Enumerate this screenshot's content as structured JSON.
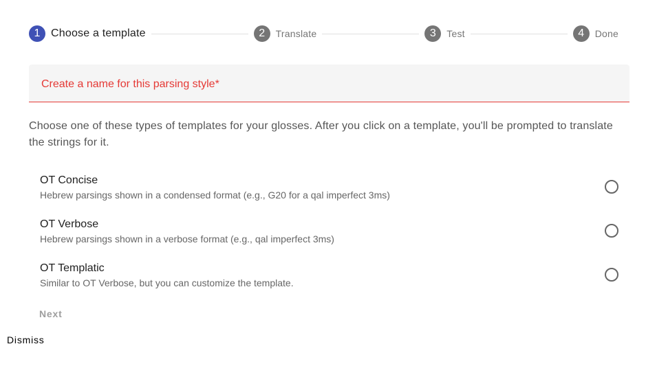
{
  "stepper": {
    "steps": [
      {
        "number": "1",
        "label": "Choose a template"
      },
      {
        "number": "2",
        "label": "Translate"
      },
      {
        "number": "3",
        "label": "Test"
      },
      {
        "number": "4",
        "label": "Done"
      }
    ],
    "active_step": "1"
  },
  "name_field": {
    "placeholder": "Create a name for this parsing style*",
    "value": ""
  },
  "instructions": "Choose one of these types of templates for your glosses. After you click on a template, you'll be prompted to translate the strings for it.",
  "templates": [
    {
      "title": "OT Concise",
      "description": "Hebrew parsings shown in a condensed format (e.g., G20 for a qal imperfect 3ms)"
    },
    {
      "title": "OT Verbose",
      "description": "Hebrew parsings shown in a verbose format (e.g., qal imperfect 3ms)"
    },
    {
      "title": "OT Templatic",
      "description": "Similar to OT Verbose, but you can customize the template."
    }
  ],
  "buttons": {
    "next": "Next",
    "dismiss": "Dismiss"
  },
  "colors": {
    "primary": "#3f51b5",
    "error": "#e53935",
    "inactive_step": "#757575"
  }
}
